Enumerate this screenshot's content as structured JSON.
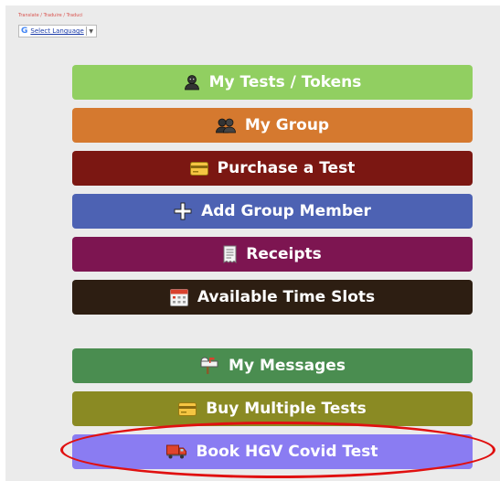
{
  "translate": {
    "caption": "Translate / Traduire / Traduci",
    "select_language": "Select Language",
    "dropdown_arrow": "▼"
  },
  "menu": {
    "my_tests": "My Tests / Tokens",
    "my_group": "My Group",
    "purchase_test": "Purchase a Test",
    "add_group_member": "Add Group Member",
    "receipts": "Receipts",
    "available_time_slots": "Available Time Slots",
    "my_messages": "My Messages",
    "buy_multiple_tests": "Buy Multiple Tests",
    "book_hgv_covid_test": "Book HGV Covid Test"
  },
  "colors": {
    "my_tests": "#91cf61",
    "my_group": "#d5792f",
    "purchase_test": "#7b1712",
    "add_group_member": "#4d62b3",
    "receipts": "#7d1551",
    "available_time_slots": "#2d1e12",
    "my_messages": "#4a8d50",
    "buy_multiple_tests": "#8a8a23",
    "book_hgv_covid_test": "#8a7cf2",
    "highlight": "#e01010"
  },
  "icons": {
    "my_tests": "person-icon",
    "my_group": "group-icon",
    "purchase_test": "credit-card-icon",
    "add_group_member": "plus-icon",
    "receipts": "receipt-icon",
    "available_time_slots": "calendar-icon",
    "my_messages": "mailbox-icon",
    "buy_multiple_tests": "credit-card-icon",
    "book_hgv_covid_test": "truck-icon"
  }
}
